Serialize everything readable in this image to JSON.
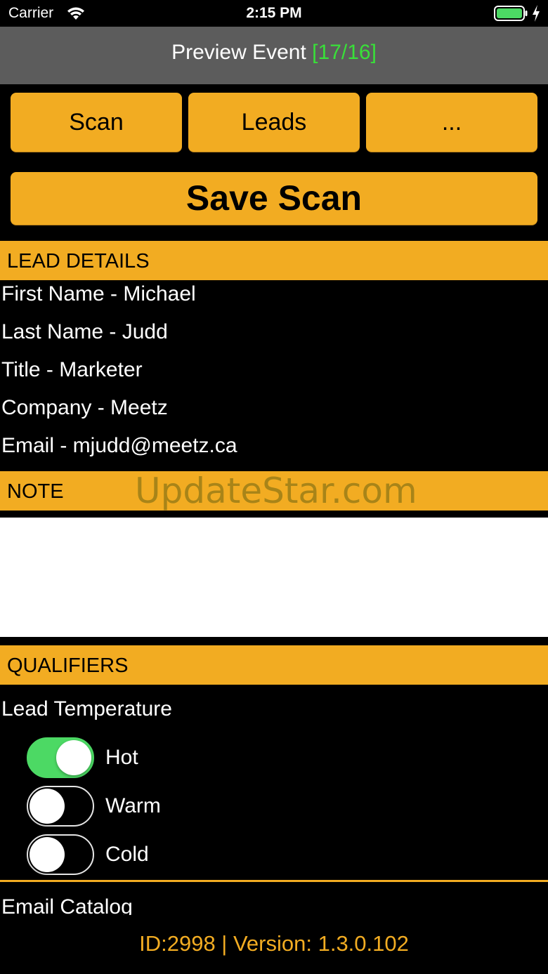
{
  "status_bar": {
    "carrier": "Carrier",
    "time": "2:15 PM",
    "icons": [
      "wifi-icon",
      "battery-icon",
      "charging-bolt-icon"
    ],
    "battery_color": "#4cd964"
  },
  "nav": {
    "title": "Preview Event",
    "count": "[17/16]",
    "count_color": "#39e039",
    "background": "#5c5c5c"
  },
  "buttons": {
    "scan": "Scan",
    "leads": "Leads",
    "more": "...",
    "save_scan": "Save Scan"
  },
  "accent_color": "#f2ac22",
  "lead_details": {
    "header": "LEAD DETAILS",
    "rows": [
      "First Name - Michael",
      "Last Name - Judd",
      "Title - Marketer",
      "Company - Meetz",
      "Email - mjudd@meetz.ca"
    ]
  },
  "note": {
    "header": "NOTE",
    "value": "",
    "watermark": "UpdateStar.com"
  },
  "qualifiers": {
    "header": "QUALIFIERS",
    "lead_temperature_label": "Lead Temperature",
    "options": [
      {
        "label": "Hot",
        "on": true
      },
      {
        "label": "Warm",
        "on": false
      },
      {
        "label": "Cold",
        "on": false
      }
    ],
    "email_catalog_label": "Email Catalog"
  },
  "footer": {
    "text": "ID:2998 | Version: 1.3.0.102"
  }
}
